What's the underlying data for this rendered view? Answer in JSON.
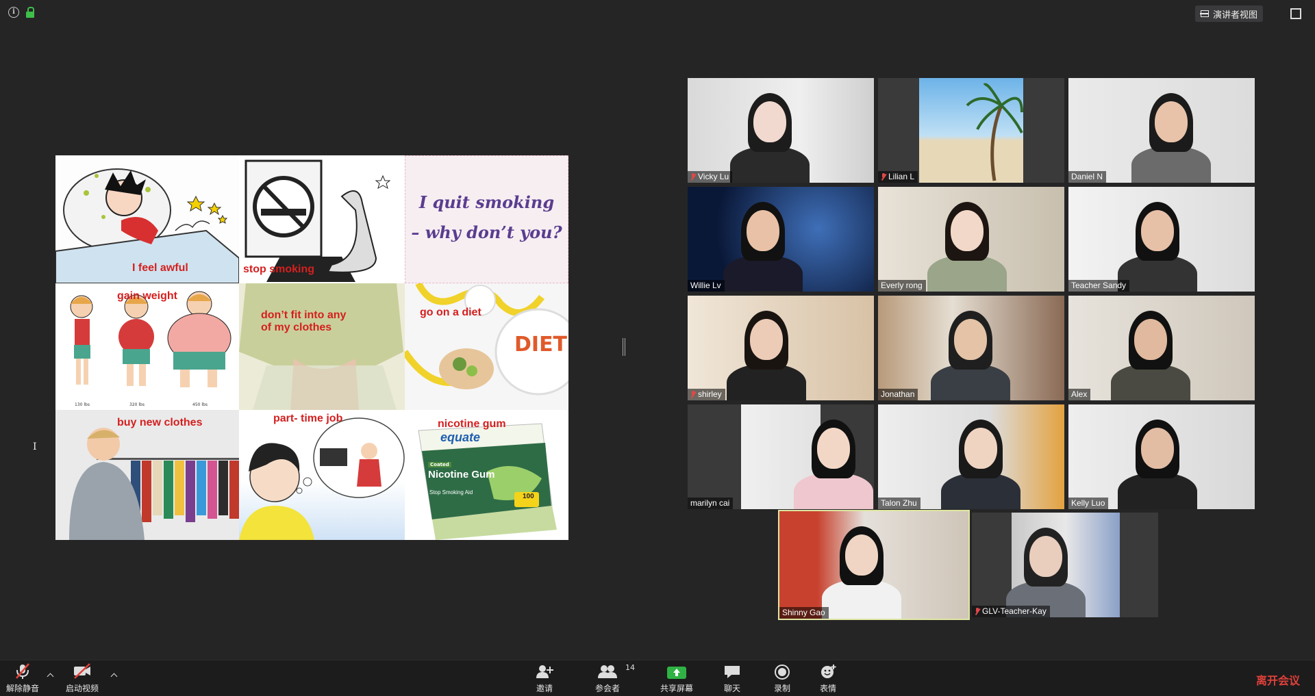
{
  "top": {
    "speaker_view_label": "演讲者视图"
  },
  "slide": {
    "cells": [
      {
        "caption": "I feel awful"
      },
      {
        "caption": "stop smoking"
      },
      {
        "quote_line1": "I quit smoking",
        "quote_line2": "– why don’t you?"
      },
      {
        "caption": "gain weight",
        "weights": [
          "130 lbs",
          "320 lbs",
          "450 lbs"
        ]
      },
      {
        "caption_line1": "don’t fit into any",
        "caption_line2": "of my clothes"
      },
      {
        "caption": "go on a diet",
        "plate_text": "DIET"
      },
      {
        "caption": "buy new clothes"
      },
      {
        "caption": "part- time job"
      },
      {
        "caption": "nicotine gum",
        "box_brand": "equate",
        "box_title": "Nicotine Gum",
        "box_sub": "Stop Smoking Aid",
        "box_badge": "Coated",
        "box_count": "100"
      }
    ]
  },
  "participants": [
    {
      "name": "Vicky Lu",
      "muted": true
    },
    {
      "name": "Lilian L",
      "muted": true
    },
    {
      "name": "Daniel N",
      "muted": false
    },
    {
      "name": "Willie Lv",
      "muted": false
    },
    {
      "name": "Everly rong",
      "muted": false
    },
    {
      "name": "Teacher Sandy",
      "muted": false
    },
    {
      "name": "shirley",
      "muted": true
    },
    {
      "name": "Jonathan",
      "muted": false
    },
    {
      "name": "Alex",
      "muted": false
    },
    {
      "name": "marilyn cai",
      "muted": false
    },
    {
      "name": "Talon Zhu",
      "muted": false
    },
    {
      "name": "Kelly Luo",
      "muted": false
    },
    {
      "name": "Shinny Gao",
      "muted": false
    },
    {
      "name": "GLV-Teacher-Kay",
      "muted": true
    }
  ],
  "toolbar": {
    "unmute_label": "解除静音",
    "start_video_label": "启动视频",
    "invite_label": "邀请",
    "participants_label": "参会者",
    "participants_count": "14",
    "share_label": "共享屏幕",
    "chat_label": "聊天",
    "record_label": "录制",
    "reactions_label": "表情",
    "leave_label": "离开会议"
  },
  "colors": {
    "background": "#252526",
    "toolbar": "#1c1c1c",
    "leave": "#e0403a",
    "share_green": "#2fb344",
    "caption_red": "#d4201f",
    "quote_purple": "#5a3d8f",
    "active_speaker_outline": "#dfe6a2"
  }
}
